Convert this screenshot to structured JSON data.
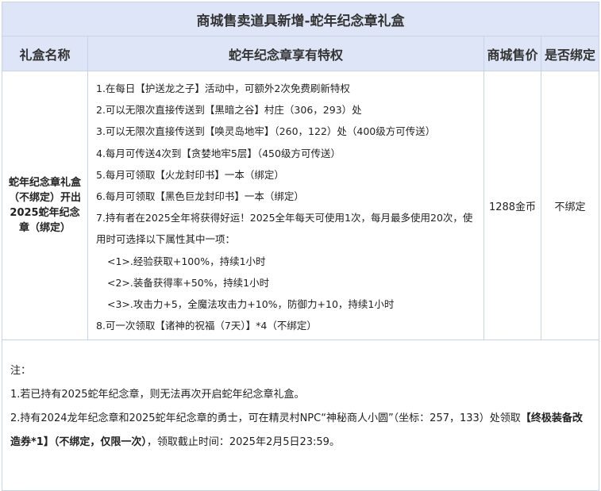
{
  "title": "商城售卖道具新增-蛇年纪念章礼盒",
  "columns": {
    "name": "礼盒名称",
    "privileges": "蛇年纪念章享有特权",
    "price": "商城售价",
    "binding": "是否绑定"
  },
  "row": {
    "name": "蛇年纪念章礼盒（不绑定）开出2025蛇年纪念章（绑定）",
    "privileges": [
      "1.在每日【护送龙之子】活动中，可额外2次免费刷新特权",
      "2.可以无限次直接传送到【黑暗之谷】村庄（306，293）处",
      "3.可以无限次直接传送到【唤灵岛地牢】（260，122）处（400级方可传送）",
      "4.每月可传送4次到【贪婪地牢5层】（450级方可传送）",
      "5.每月可领取【火龙封印书】一本（绑定）",
      "6.每月可领取【黑色巨龙封印书】一本（绑定）",
      "7.持有者在2025全年将获得好运！2025全年每天可使用1次，每月最多使用20次，使用时可选择以下属性其中一项：",
      "<1>.经验获取+100%，持续1小时",
      "<2>.装备获得率+50%，持续1小时",
      "<3>.攻击力+5，全魔法攻击力+10%，防御力+10，持续1小时",
      "8.可一次领取【诸神的祝福（7天）】*4（不绑定）"
    ],
    "price": "1288金币",
    "binding": "不绑定"
  },
  "notes": {
    "label": "注：",
    "items": [
      "1.若已持有2025蛇年纪念章，则无法再次开启蛇年纪念章礼盒。",
      "2.持有2024龙年纪念章和2025蛇年纪念章的勇士，可在精灵村NPC“神秘商人小圆”（坐标：257，133）处领取",
      "【终极装备改造券*1】（不绑定，仅限一次）",
      "，领取截止时间：2025年2月5日23:59。"
    ]
  }
}
